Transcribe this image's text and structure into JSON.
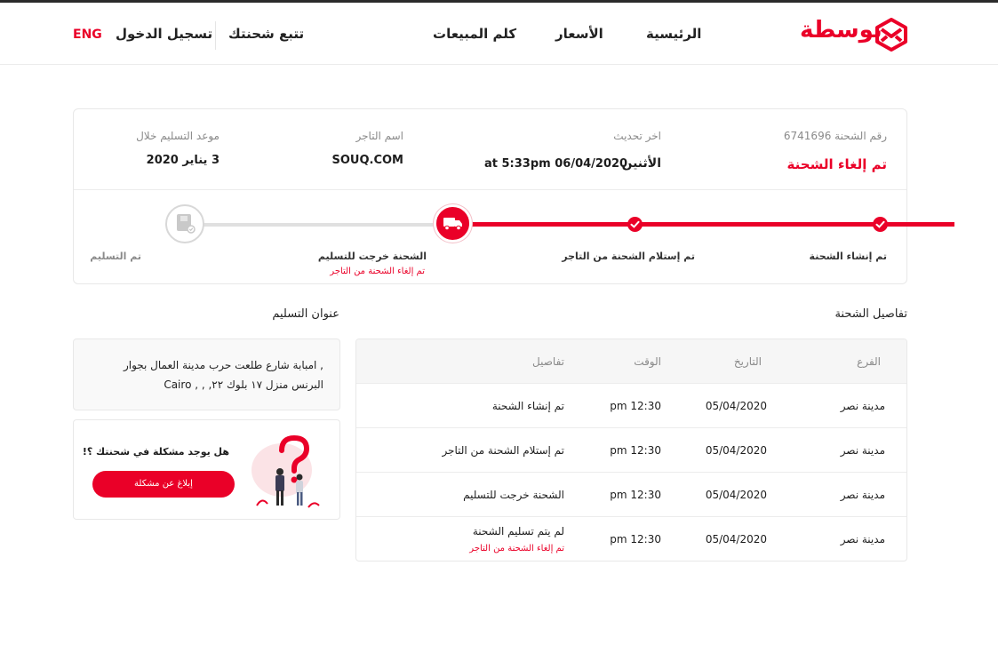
{
  "brand": {
    "name": "بوسطة",
    "color": "#ea0028"
  },
  "nav": {
    "home": "الرئيسية",
    "prices": "الأسعار",
    "sales": "كلم المبيعات",
    "track": "تتبع شحنتك",
    "login": "تسجيل الدخول",
    "lang": "ENG"
  },
  "shipment": {
    "number_label": "رقم الشحنة 6741696",
    "status": "تم إلغاء الشحنة",
    "last_update_label": "اخر تحديث",
    "last_update_day": "الأثنين",
    "last_update_value": "at 5:33pm 06/04/2020",
    "merchant_label": "اسم التاجر",
    "merchant_value": "SOUQ.COM",
    "delivery_label": "موعد التسليم خلال",
    "delivery_value": "3 يناير 2020"
  },
  "progress": {
    "steps": [
      {
        "label": "تم إنشاء الشحنة",
        "icon": "check-icon"
      },
      {
        "label": "تم إستلام الشحنة من التاجر",
        "icon": "check-icon"
      },
      {
        "label": "الشحنة خرجت للتسليم",
        "sub": "تم إلغاء الشحنة من التاجر",
        "icon": "truck-icon"
      },
      {
        "label": "تم التسليم",
        "icon": "box-icon"
      }
    ]
  },
  "details": {
    "title": "تفاصيل الشحنة",
    "headers": {
      "branch": "الفرع",
      "date": "التاريخ",
      "time": "الوقت",
      "details": "تفاصيل"
    },
    "rows": [
      {
        "branch": "مدينة نصر",
        "date": "05/04/2020",
        "time": "12:30 pm",
        "details": "تم إنشاء الشحنة"
      },
      {
        "branch": "مدينة نصر",
        "date": "05/04/2020",
        "time": "12:30 pm",
        "details": "تم إستلام الشحنة من التاجر"
      },
      {
        "branch": "مدينة نصر",
        "date": "05/04/2020",
        "time": "12:30 pm",
        "details": "الشحنة خرجت للتسليم"
      },
      {
        "branch": "مدينة نصر",
        "date": "05/04/2020",
        "time": "12:30 pm",
        "details": "لم يتم تسليم الشحنة",
        "sub": "تم إلغاء الشحنة من التاجر"
      }
    ]
  },
  "address": {
    "title": "عنوان التسليم",
    "text": ", امبابة شارع طلعت حرب مدينة العمال بجوار البرنس منزل ١٧ بلوك ٢٢, , , Cairo"
  },
  "problem": {
    "question": "هل يوجد مشكلة في شحنتك ؟!",
    "button": "إبلاغ عن مشكلة"
  }
}
